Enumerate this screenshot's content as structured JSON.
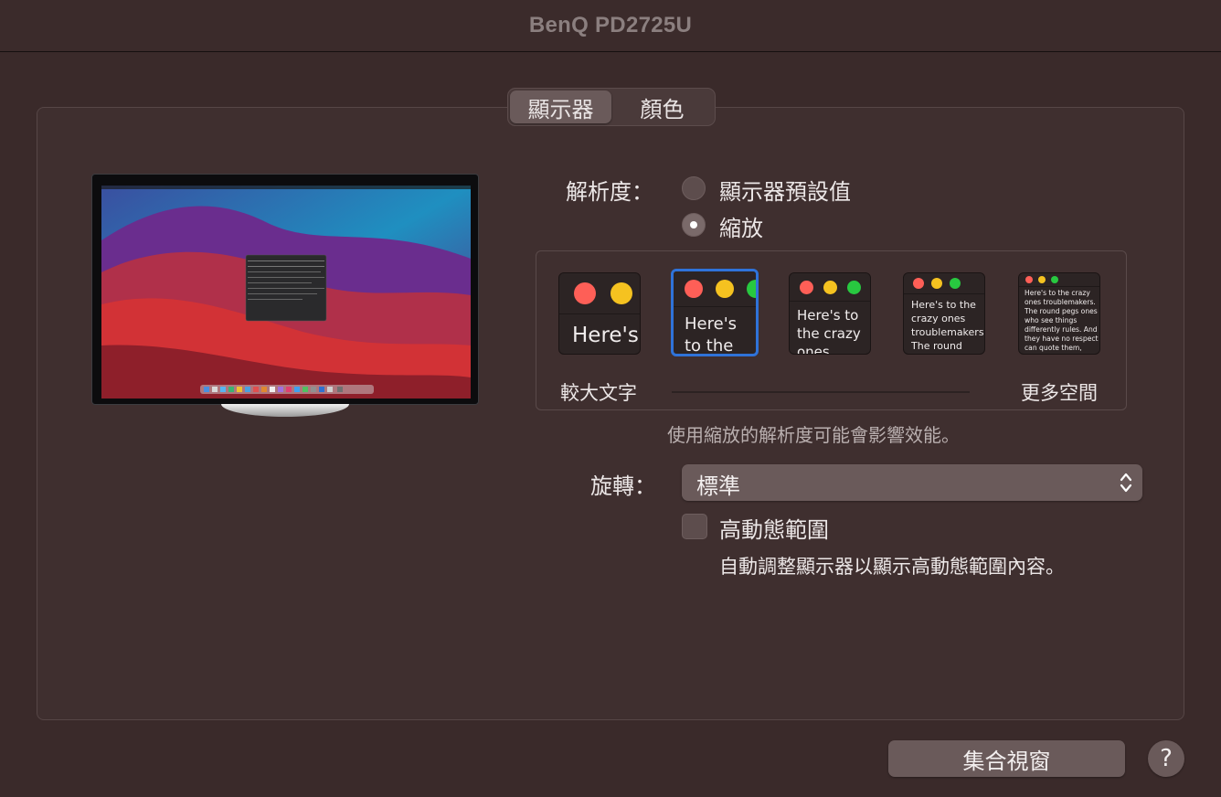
{
  "window": {
    "title": "BenQ PD2725U"
  },
  "tabs": [
    {
      "label": "顯示器",
      "active": true
    },
    {
      "label": "顏色",
      "active": false
    }
  ],
  "resolution": {
    "label": "解析度：",
    "options": [
      {
        "label": "顯示器預設值",
        "selected": false
      },
      {
        "label": "縮放",
        "selected": true
      }
    ]
  },
  "scaling": {
    "left_label": "較大文字",
    "right_label": "更多空間",
    "sample_text": "Here's to the crazy ones troublemakers. The round pegs ones who see things differently rules. And they have no respect can quote them, disagree with them. About the only thing Because they change things",
    "selected_index": 1,
    "note": "使用縮放的解析度可能會影響效能。"
  },
  "rotation": {
    "label": "旋轉：",
    "value": "標準"
  },
  "hdr": {
    "label": "高動態範圍",
    "checked": false,
    "description": "自動調整顯示器以顯示高動態範圍內容。"
  },
  "buttons": {
    "gather_windows": "集合視窗",
    "help": "?"
  },
  "colors": {
    "accent": "#2f73d9",
    "window_bg": "#3a2a2a",
    "traffic_red": "#fe5f57",
    "traffic_yellow": "#febc2e",
    "traffic_green": "#28c840"
  },
  "icons": {
    "help": "question-mark-icon",
    "select": "updown-chevron-icon",
    "traffic_lights": "window-controls-icon"
  }
}
